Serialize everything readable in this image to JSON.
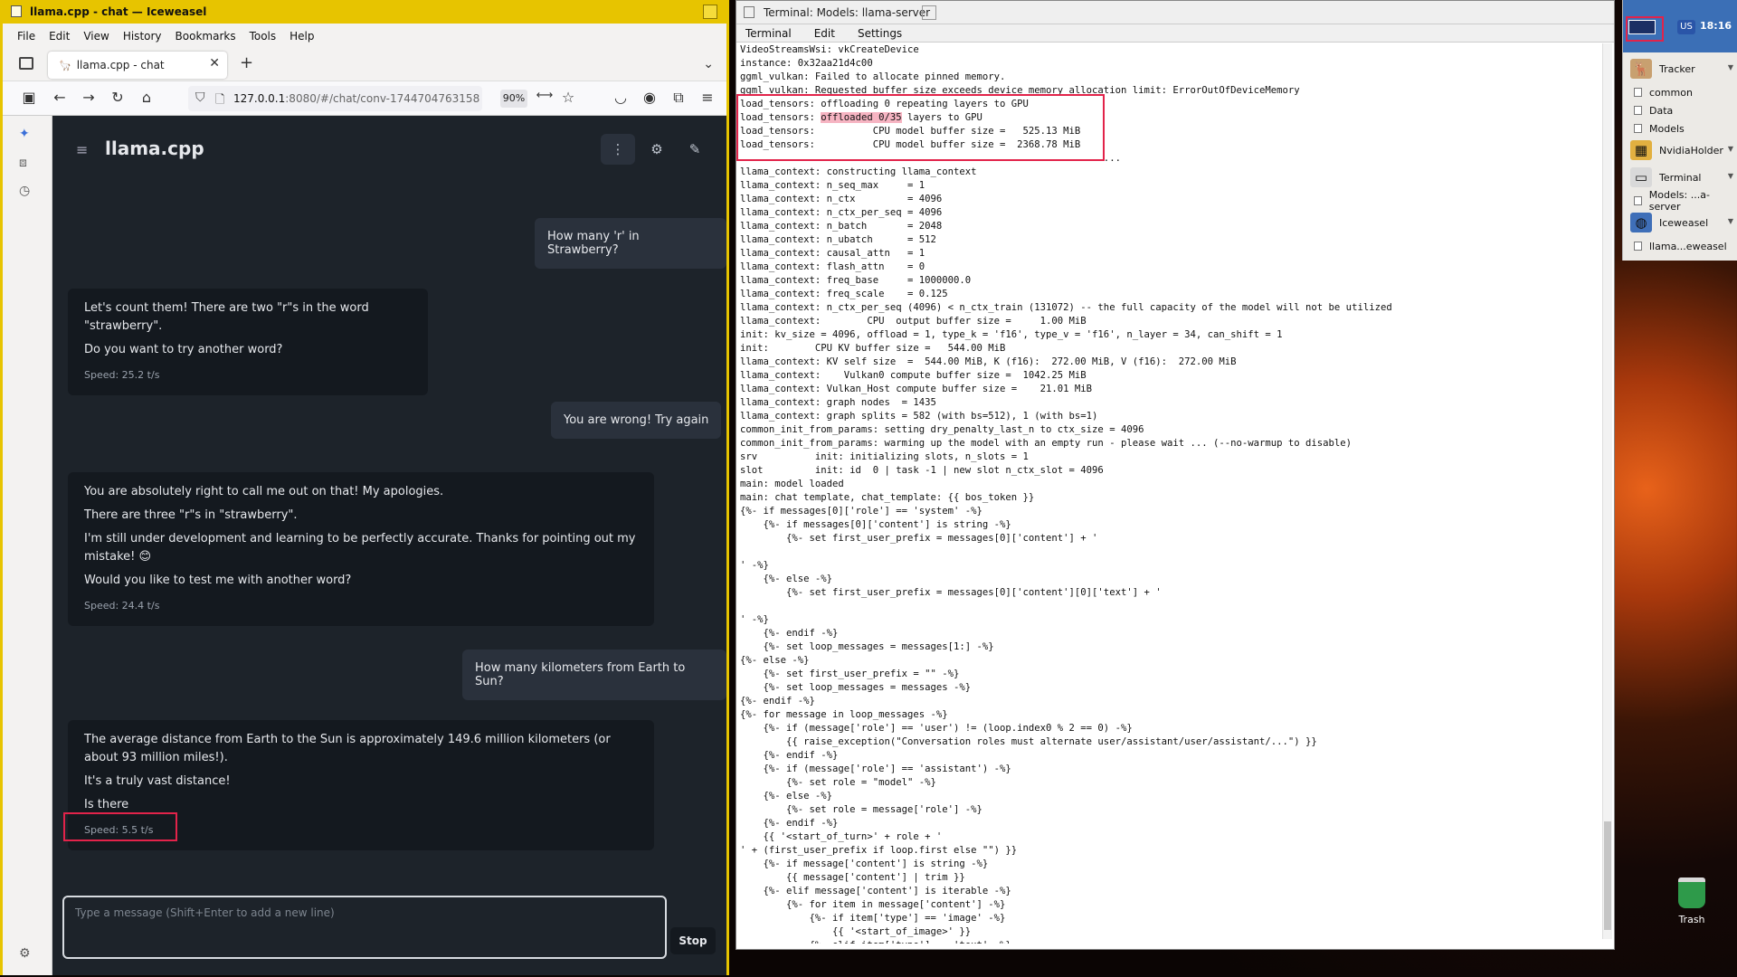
{
  "browser": {
    "window_title": "llama.cpp - chat — Iceweasel",
    "menu": [
      "File",
      "Edit",
      "View",
      "History",
      "Bookmarks",
      "Tools",
      "Help"
    ],
    "tab_title": "llama.cpp - chat",
    "url_host": "127.0.0.1",
    "url_rest": ":8080/#/chat/conv-1744704763158",
    "zoom": "90%"
  },
  "app": {
    "title": "llama.cpp",
    "messages": [
      {
        "role": "user",
        "text": "How many 'r' in Strawberry?"
      },
      {
        "role": "assistant",
        "lines": [
          "Let's count them! There are two \"r\"s in the word \"strawberry\".",
          "Do you want to try another word?"
        ],
        "speed": "Speed: 25.2 t/s"
      },
      {
        "role": "user",
        "text": "You are wrong! Try again"
      },
      {
        "role": "assistant",
        "lines": [
          "You are absolutely right to call me out on that! My apologies.",
          "There are three \"r\"s in \"strawberry\".",
          "I'm still under development and learning to be perfectly accurate. Thanks for pointing out my mistake! 😊",
          "Would you like to test me with another word?"
        ],
        "speed": "Speed: 24.4 t/s"
      },
      {
        "role": "user",
        "text": "How many kilometers from Earth to Sun?"
      },
      {
        "role": "assistant",
        "lines": [
          "The average distance from Earth to the Sun is approximately 149.6 million kilometers (or about 93 million miles!).",
          "It's a truly vast distance!",
          "Is there"
        ],
        "speed": "Speed: 5.5 t/s"
      }
    ],
    "input_placeholder": "Type a message (Shift+Enter to add a new line)",
    "stop_label": "Stop"
  },
  "terminal": {
    "window_title": "Terminal: Models: llama-server",
    "menu": [
      "Terminal",
      "Edit",
      "Settings"
    ],
    "lines": [
      "VideoStreamsWsi: vkCreateDevice",
      "instance: 0x32aa21d4c00",
      "ggml_vulkan: Failed to allocate pinned memory.",
      "ggml_vulkan: Requested buffer size exceeds device memory allocation limit: ErrorOutOfDeviceMemory",
      "load_tensors: offloading 0 repeating layers to GPU",
      "load_tensors: offloaded 0/35 layers to GPU",
      "load_tensors:          CPU model buffer size =   525.13 MiB",
      "load_tensors:          CPU model buffer size =  2368.78 MiB",
      "..................................................................",
      "llama_context: constructing llama_context",
      "llama_context: n_seq_max     = 1",
      "llama_context: n_ctx         = 4096",
      "llama_context: n_ctx_per_seq = 4096",
      "llama_context: n_batch       = 2048",
      "llama_context: n_ubatch      = 512",
      "llama_context: causal_attn   = 1",
      "llama_context: flash_attn    = 0",
      "llama_context: freq_base     = 1000000.0",
      "llama_context: freq_scale    = 0.125",
      "llama_context: n_ctx_per_seq (4096) < n_ctx_train (131072) -- the full capacity of the model will not be utilized",
      "llama_context:        CPU  output buffer size =     1.00 MiB",
      "init: kv_size = 4096, offload = 1, type_k = 'f16', type_v = 'f16', n_layer = 34, can_shift = 1",
      "init:        CPU KV buffer size =   544.00 MiB",
      "llama_context: KV self size  =  544.00 MiB, K (f16):  272.00 MiB, V (f16):  272.00 MiB",
      "llama_context:    Vulkan0 compute buffer size =  1042.25 MiB",
      "llama_context: Vulkan_Host compute buffer size =    21.01 MiB",
      "llama_context: graph nodes  = 1435",
      "llama_context: graph splits = 582 (with bs=512), 1 (with bs=1)",
      "common_init_from_params: setting dry_penalty_last_n to ctx_size = 4096",
      "common_init_from_params: warming up the model with an empty run - please wait ... (--no-warmup to disable)",
      "srv          init: initializing slots, n_slots = 1",
      "slot         init: id  0 | task -1 | new slot n_ctx_slot = 4096",
      "main: model loaded",
      "main: chat template, chat_template: {{ bos_token }}",
      "{%- if messages[0]['role'] == 'system' -%}",
      "    {%- if messages[0]['content'] is string -%}",
      "        {%- set first_user_prefix = messages[0]['content'] + '",
      "",
      "' -%}",
      "    {%- else -%}",
      "        {%- set first_user_prefix = messages[0]['content'][0]['text'] + '",
      "",
      "' -%}",
      "    {%- endif -%}",
      "    {%- set loop_messages = messages[1:] -%}",
      "{%- else -%}",
      "    {%- set first_user_prefix = \"\" -%}",
      "    {%- set loop_messages = messages -%}",
      "{%- endif -%}",
      "{%- for message in loop_messages -%}",
      "    {%- if (message['role'] == 'user') != (loop.index0 % 2 == 0) -%}",
      "        {{ raise_exception(\"Conversation roles must alternate user/assistant/user/assistant/...\") }}",
      "    {%- endif -%}",
      "    {%- if (message['role'] == 'assistant') -%}",
      "        {%- set role = \"model\" -%}",
      "    {%- else -%}",
      "        {%- set role = message['role'] -%}",
      "    {%- endif -%}",
      "    {{ '<start_of_turn>' + role + '",
      "' + (first_user_prefix if loop.first else \"\") }}",
      "    {%- if message['content'] is string -%}",
      "        {{ message['content'] | trim }}",
      "    {%- elif message['content'] is iterable -%}",
      "        {%- for item in message['content'] -%}",
      "            {%- if item['type'] == 'image' -%}",
      "                {{ '<start_of_image>' }}",
      "            {%- elif item['type'] == 'text' -%}"
    ]
  },
  "panel": {
    "clock": "18:16",
    "kbd": "US",
    "items": [
      {
        "kind": "big",
        "label": "Tracker",
        "icon": "tracker-icon"
      },
      {
        "kind": "small",
        "label": "common"
      },
      {
        "kind": "small",
        "label": "Data"
      },
      {
        "kind": "small",
        "label": "Models"
      },
      {
        "kind": "big",
        "label": "NvidiaHolder",
        "icon": "cubes-icon"
      },
      {
        "kind": "big",
        "label": "Terminal",
        "icon": "terminal-icon"
      },
      {
        "kind": "small",
        "label": "Models: ...a-server"
      },
      {
        "kind": "big",
        "label": "Iceweasel",
        "icon": "globe-icon"
      },
      {
        "kind": "small",
        "label": "llama...eweasel"
      }
    ]
  },
  "desktop": {
    "trash_label": "Trash"
  }
}
